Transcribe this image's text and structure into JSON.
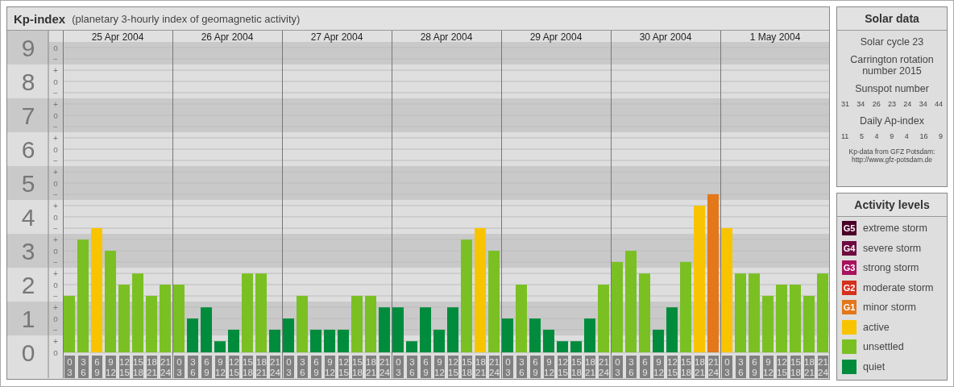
{
  "title": {
    "name": "Kp-index",
    "subtitle": "(planetary 3-hourly index of geomagnetic activity)"
  },
  "kp_chart": {
    "sub_tick_labels": [
      "o",
      "−",
      "+",
      "o",
      "−",
      "+",
      "o",
      "−",
      "+",
      "o",
      "−",
      "+",
      "o",
      "−",
      "+",
      "o",
      "−",
      "+",
      "o",
      "−",
      "+",
      "o",
      "−",
      "+",
      "o",
      "−",
      "+",
      "o"
    ],
    "days": [
      "25 Apr 2004",
      "26 Apr 2004",
      "27 Apr 2004",
      "28 Apr 2004",
      "29 Apr 2004",
      "30 Apr 2004",
      "1 May 2004"
    ],
    "chart_data": {
      "type": "bar",
      "ylim": [
        -0.76,
        9.5
      ],
      "grid": true,
      "yticks": [
        9,
        8,
        7,
        6,
        5,
        4,
        3,
        2,
        1,
        0
      ],
      "categories": [
        "0 3",
        "3 6",
        "6 9",
        "9 12",
        "12 15",
        "15 18",
        "18 21",
        "21 24",
        "0 3",
        "3 6",
        "6 9",
        "9 12",
        "12 15",
        "15 18",
        "18 21",
        "21 24",
        "0 3",
        "3 6",
        "6 9",
        "9 12",
        "12 15",
        "15 18",
        "18 21",
        "21 24",
        "0 3",
        "3 6",
        "6 9",
        "9 12",
        "12 15",
        "15 18",
        "18 21",
        "21 24",
        "0 3",
        "3 6",
        "6 9",
        "9 12",
        "12 15",
        "15 18",
        "18 21",
        "21 24",
        "0 3",
        "3 6",
        "6 9",
        "9 12",
        "12 15",
        "15 18",
        "18 21",
        "21 24",
        "0 3",
        "3 6",
        "6 9",
        "9 12",
        "12 15",
        "15 18",
        "18 21",
        "21 24"
      ],
      "values": [
        1.67,
        3.33,
        3.67,
        3,
        2,
        2.33,
        1.67,
        2,
        2,
        1,
        1.33,
        0.33,
        0.67,
        2.33,
        2.33,
        0.67,
        1,
        1.67,
        0.67,
        0.67,
        0.67,
        1.67,
        1.67,
        1.33,
        1.33,
        0.33,
        1.33,
        0.67,
        1.33,
        3.33,
        3.67,
        3,
        1,
        2,
        1,
        0.67,
        0.33,
        0.33,
        1,
        2,
        2.67,
        3,
        2.33,
        0.67,
        1.33,
        2.67,
        4.33,
        4.67,
        3.67,
        2.33,
        2.33,
        1.67,
        2,
        2,
        1.67,
        2.33
      ]
    }
  },
  "solar_data": {
    "title": "Solar data",
    "cycle": "Solar cycle 23",
    "carrington": "Carrington rotation number 2015",
    "sunspot_title": "Sunspot number",
    "sunspot_numbers": [
      "31",
      "34",
      "26",
      "23",
      "24",
      "34",
      "44"
    ],
    "ap_title": "Daily Ap-index",
    "ap_values": [
      "11",
      "5",
      "4",
      "9",
      "4",
      "16",
      "9"
    ],
    "source": "Kp-data from GFZ Potsdam:",
    "source_url": "http://www.gfz-potsdam.de"
  },
  "activity_levels": {
    "title": "Activity levels",
    "items": [
      {
        "badge": "G5",
        "label": "extreme storm",
        "color": "#4a0026"
      },
      {
        "badge": "G4",
        "label": "severe storm",
        "color": "#6e0a40"
      },
      {
        "badge": "G3",
        "label": "strong storm",
        "color": "#a8125e"
      },
      {
        "badge": "G2",
        "label": "moderate storm",
        "color": "#d4301e"
      },
      {
        "badge": "G1",
        "label": "minor storm",
        "color": "#e3771a"
      },
      {
        "label": "active",
        "color": "#f8c400"
      },
      {
        "label": "unsettled",
        "color": "#7ac023"
      },
      {
        "label": "quiet",
        "color": "#008c3c"
      }
    ]
  }
}
